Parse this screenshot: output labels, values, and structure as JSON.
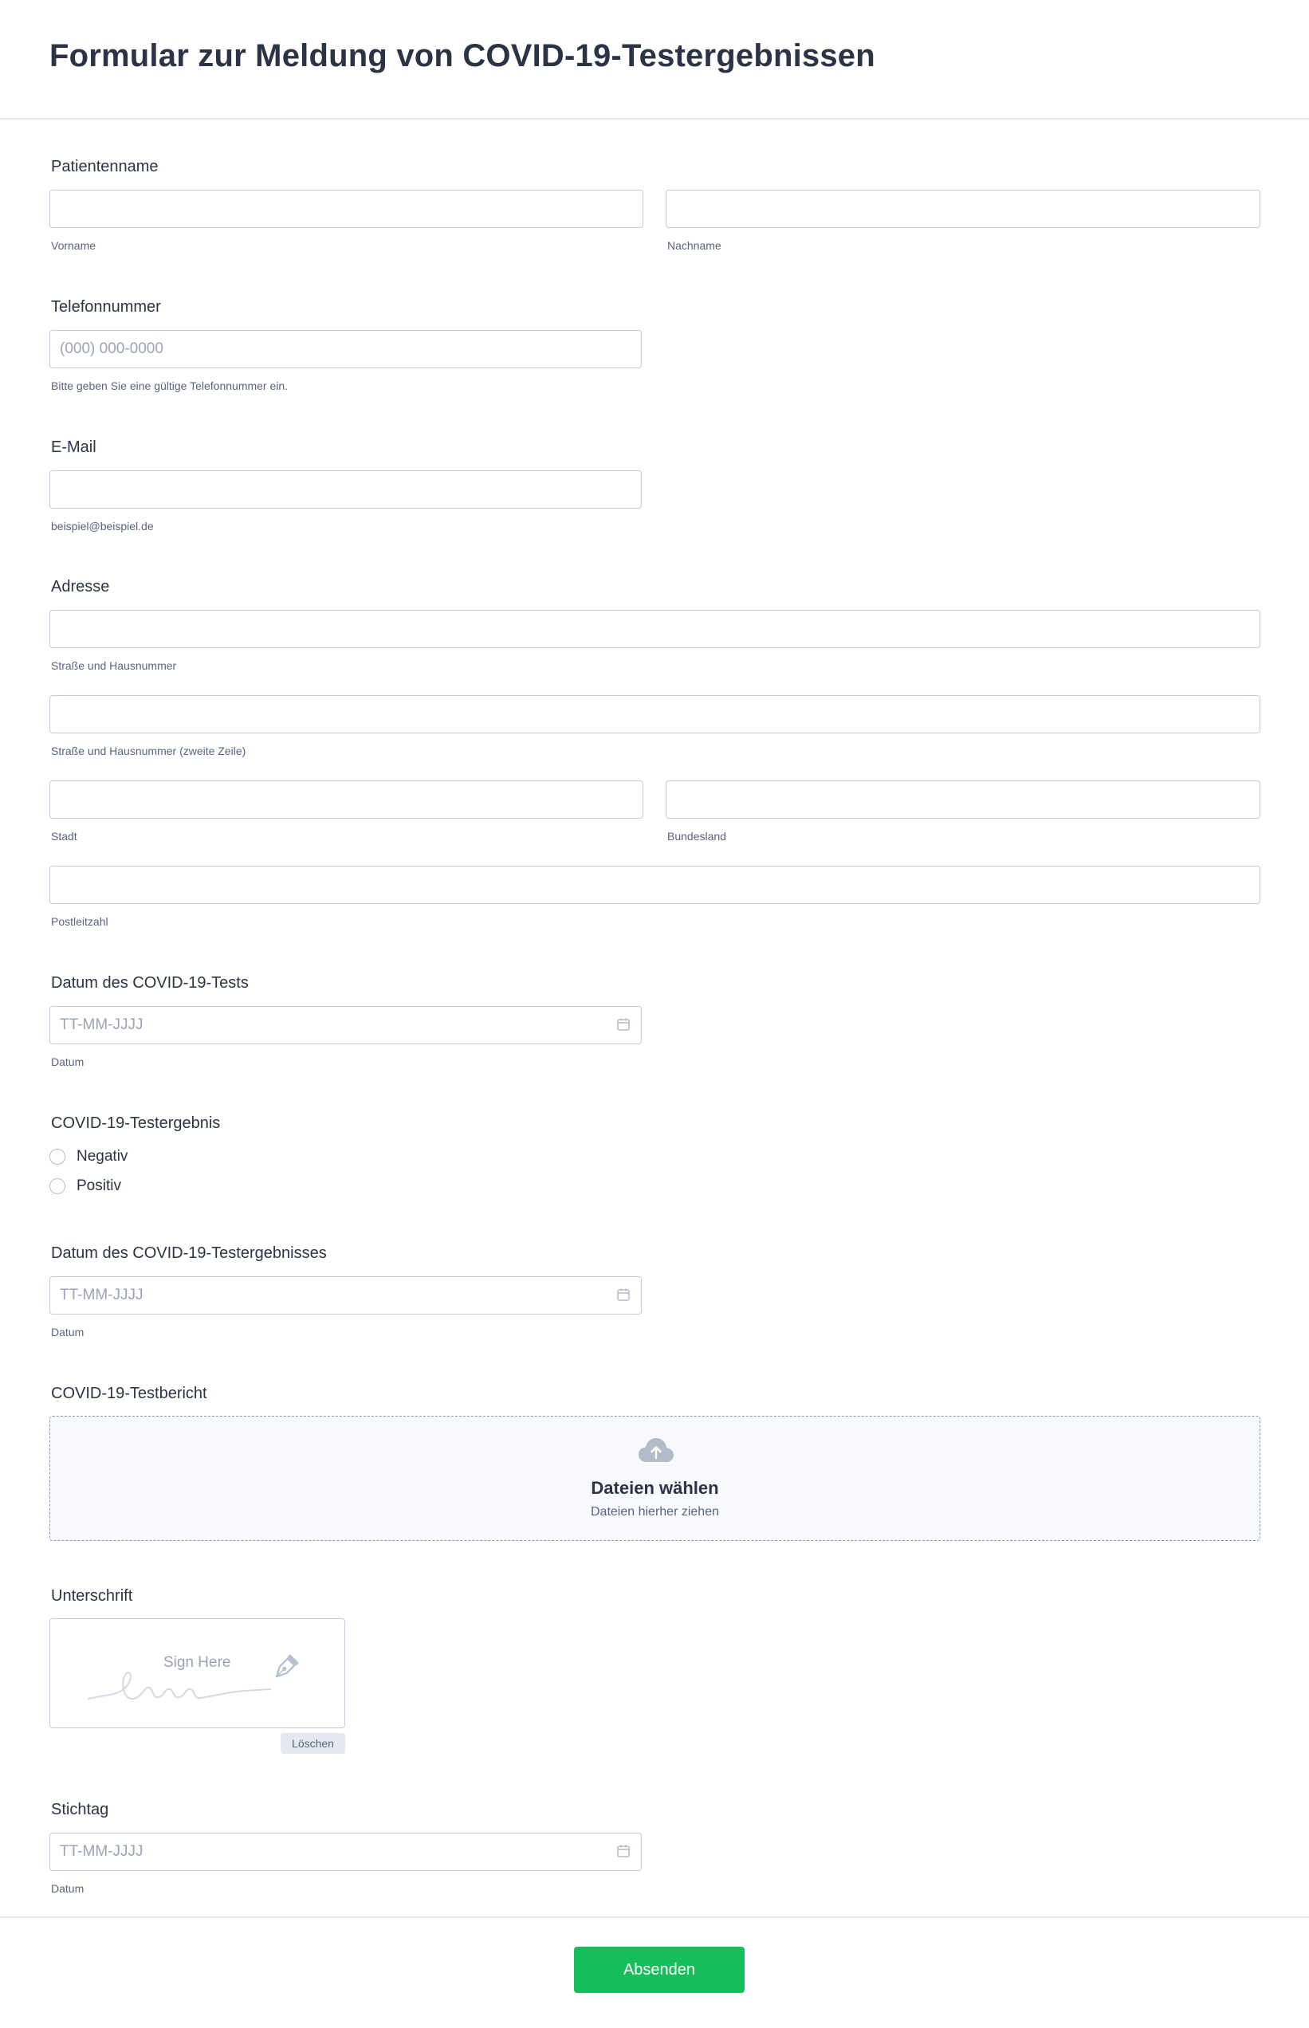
{
  "form": {
    "title": "Formular zur Meldung von COVID-19-Testergebnissen"
  },
  "patient_name": {
    "label": "Patientenname",
    "first_sublabel": "Vorname",
    "last_sublabel": "Nachname"
  },
  "phone": {
    "label": "Telefonnummer",
    "placeholder": "(000) 000-0000",
    "sublabel": "Bitte geben Sie eine gültige Telefonnummer ein."
  },
  "email": {
    "label": "E-Mail",
    "sublabel": "beispiel@beispiel.de"
  },
  "address": {
    "label": "Adresse",
    "street_sublabel": "Straße und Hausnummer",
    "street2_sublabel": "Straße und Hausnummer (zweite Zeile)",
    "city_sublabel": "Stadt",
    "state_sublabel": "Bundesland",
    "zip_sublabel": "Postleitzahl"
  },
  "test_date": {
    "label": "Datum des COVID-19-Tests",
    "placeholder": "TT-MM-JJJJ",
    "sublabel": "Datum",
    "icon": "calendar-icon"
  },
  "test_result": {
    "label": "COVID-19-Testergebnis",
    "options": [
      "Negativ",
      "Positiv"
    ]
  },
  "result_date": {
    "label": "Datum des COVID-19-Testergebnisses",
    "placeholder": "TT-MM-JJJJ",
    "sublabel": "Datum",
    "icon": "calendar-icon"
  },
  "report": {
    "label": "COVID-19-Testbericht",
    "upload_title": "Dateien wählen",
    "upload_sub": "Dateien hierher ziehen",
    "icon": "cloud-upload-icon"
  },
  "signature": {
    "label": "Unterschrift",
    "placeholder": "Sign Here",
    "clear_label": "Löschen",
    "icon": "pen-nib-icon"
  },
  "reference_date": {
    "label": "Stichtag",
    "placeholder": "TT-MM-JJJJ",
    "sublabel": "Datum",
    "icon": "calendar-icon"
  },
  "footer": {
    "submit_label": "Absenden"
  },
  "colors": {
    "submit": "#18bd5b",
    "text": "#2c3345",
    "border": "#c3cad8",
    "sublabel": "#57647e"
  }
}
